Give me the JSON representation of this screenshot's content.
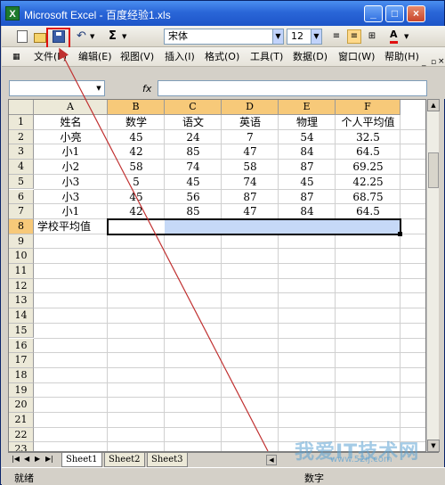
{
  "window": {
    "title": "Microsoft Excel - 百度经验1.xls",
    "app_icon": "X"
  },
  "toolbar": {
    "sum_label": "Σ",
    "font_name": "宋体",
    "font_size": "12",
    "font_color_label": "A"
  },
  "menubar": {
    "items": [
      "文件(F)",
      "编辑(E)",
      "视图(V)",
      "插入(I)",
      "格式(O)",
      "工具(T)",
      "数据(D)",
      "窗口(W)",
      "帮助(H)"
    ]
  },
  "formula_bar": {
    "fx": "fx",
    "name_box": "",
    "formula": ""
  },
  "sheet": {
    "columns": [
      "A",
      "B",
      "C",
      "D",
      "E",
      "F"
    ],
    "rows": [
      "1",
      "2",
      "3",
      "4",
      "5",
      "6",
      "7",
      "8",
      "9",
      "10",
      "11",
      "12",
      "13",
      "14",
      "15",
      "16",
      "17",
      "18",
      "19",
      "20",
      "21",
      "22",
      "23"
    ],
    "cells": [
      [
        "姓名",
        "数学",
        "语文",
        "英语",
        "物理",
        "个人平均值"
      ],
      [
        "小亮",
        "45",
        "24",
        "7",
        "54",
        "32.5"
      ],
      [
        "小1",
        "42",
        "85",
        "47",
        "84",
        "64.5"
      ],
      [
        "小2",
        "58",
        "74",
        "58",
        "87",
        "69.25"
      ],
      [
        "小3",
        "5",
        "45",
        "74",
        "45",
        "42.25"
      ],
      [
        "小3",
        "45",
        "56",
        "87",
        "87",
        "68.75"
      ],
      [
        "小1",
        "42",
        "85",
        "47",
        "84",
        "64.5"
      ],
      [
        "学校平均值",
        "",
        "",
        "",
        "",
        ""
      ]
    ],
    "selected_range": "B8:F8"
  },
  "tabs": [
    "Sheet1",
    "Sheet2",
    "Sheet3"
  ],
  "status": {
    "left": "就绪",
    "right": "数字"
  },
  "watermark": {
    "main": "我爱IT技术网",
    "sub": "www.52ij.com"
  },
  "colors": {
    "title_bar": "#2a66d8",
    "highlight_box": "#e01010",
    "selection_header": "#f7c979",
    "arrow": "#c03030"
  }
}
